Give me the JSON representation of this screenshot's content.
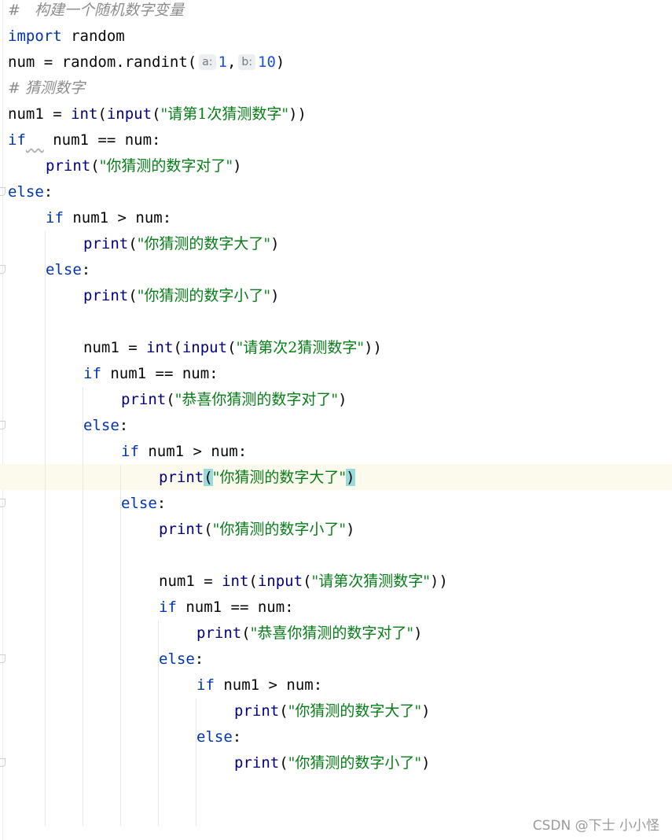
{
  "lines": [
    {
      "comment": "#   构建一个随机数字变量"
    },
    {
      "kw": "import",
      "rest": " random"
    },
    {
      "pre": "num = random.randint(",
      "hint_a": "a:",
      "arg_a": "1",
      "comma": ",",
      "hint_b": "b:",
      "arg_b": "10",
      "close": ")"
    },
    {
      "comment": "# 猜测数字"
    },
    {
      "pre": "num1 = ",
      "b1": "int",
      "p1": "(",
      "b2": "input",
      "p2": "(",
      "str": "\"请第1次猜测数字\"",
      "post": "))"
    },
    {
      "kw": "if",
      "sp": "  ",
      "rest": " num1 == num:"
    },
    {
      "fn": "print",
      "lp": "(",
      "str": "\"你猜测的数字对了\"",
      "rp": ")"
    },
    {
      "kw": "else",
      "rest": ":"
    },
    {
      "kw": "if",
      "rest": " num1 > num:"
    },
    {
      "fn": "print",
      "lp": "(",
      "str": "\"你猜测的数字大了\"",
      "rp": ")"
    },
    {
      "kw": "else",
      "rest": ":"
    },
    {
      "fn": "print",
      "lp": "(",
      "str": "\"你猜测的数字小了\"",
      "rp": ")"
    },
    {},
    {
      "pre": "num1 = ",
      "b1": "int",
      "p1": "(",
      "b2": "input",
      "p2": "(",
      "str": "\"请第次2猜测数字\"",
      "post": "))"
    },
    {
      "kw": "if",
      "rest": " num1 == num:"
    },
    {
      "fn": "print",
      "lp": "(",
      "str": "\"恭喜你猜测的数字对了\"",
      "rp": ")"
    },
    {
      "kw": "else",
      "rest": ":"
    },
    {
      "kw": "if",
      "rest": " num1 > num:"
    },
    {
      "fn": "print",
      "lp": "(",
      "str": "\"你猜测的数字大了\"",
      "rp": ")"
    },
    {
      "kw": "else",
      "rest": ":"
    },
    {
      "fn": "print",
      "lp": "(",
      "str": "\"你猜测的数字小了\"",
      "rp": ")"
    },
    {},
    {
      "pre": "num1 = ",
      "b1": "int",
      "p1": "(",
      "b2": "input",
      "p2": "(",
      "str": "\"请第次猜测数字\"",
      "post": "))"
    },
    {
      "kw": "if",
      "rest": " num1 == num:"
    },
    {
      "fn": "print",
      "lp": "(",
      "str": "\"恭喜你猜测的数字对了\"",
      "rp": ")"
    },
    {
      "kw": "else",
      "rest": ":"
    },
    {
      "kw": "if",
      "rest": " num1 > num:"
    },
    {
      "fn": "print",
      "lp": "(",
      "str": "\"你猜测的数字大了\"",
      "rp": ")"
    },
    {
      "kw": "else",
      "rest": ":"
    },
    {
      "fn": "print",
      "lp": "(",
      "str": "\"你猜测的数字小了\"",
      "rp": ")"
    }
  ],
  "watermark": "CSDN @下士  小小怪",
  "colors": {
    "keyword": "#0033b3",
    "builtin": "#000080",
    "string": "#067d17",
    "number": "#1750eb",
    "comment": "#8c8c8c",
    "caret_line": "#fcfaed",
    "brace_match": "#99dada"
  }
}
